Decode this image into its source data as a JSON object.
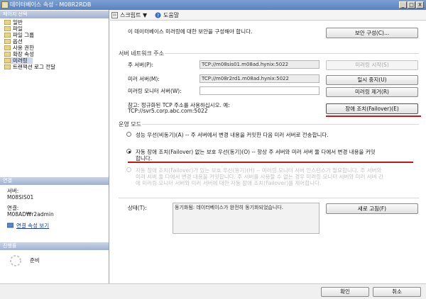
{
  "window": {
    "title": "데이터베이스 속성 - M08R2RDB",
    "controls": [
      "_",
      "□",
      "X"
    ]
  },
  "left": {
    "select_page_header": "페이지 선택",
    "nav_items": [
      "일반",
      "파일",
      "파일 그룹",
      "옵션",
      "사용 권한",
      "확장 속성",
      "미러링",
      "트랜잭션 로그 전달"
    ],
    "selected_index": 6,
    "connection_header": "연결",
    "server_label": "서버:",
    "server_value": "M08SIS01",
    "connection_label": "연결:",
    "connection_value": "M08AD₩r2admin",
    "connection_link": "연결 속성 보기",
    "progress_header": "진행률",
    "progress_status": "준비"
  },
  "toolbar": {
    "script_label": "스크립트 ▼",
    "help_label": "도움말"
  },
  "main": {
    "intro": "이 데이터베이스 미러링에 대한 보안을 구성해야 합니다.",
    "configure_security_button": "보안 구성(C)...",
    "network_group_label": "서버 네트워크 주소",
    "principal_label": "주 서버(P):",
    "principal_value": "TCP://m08sis01.m08ad.hynix:5022",
    "mirror_label": "미러 서버(M):",
    "mirror_value": "TCP://m08r2rd1.m08ad.hynix:5022",
    "witness_label": "미러링 모니터 서버(W):",
    "witness_value": "",
    "start_mirroring_button": "미러링 시작(S)",
    "pause_button": "일시 중지(U)",
    "remove_mirroring_button": "미러링 제거(R)",
    "failover_button": "장애 조치(Failover)(E)",
    "note_line1": "참고: 정규화된 TCP 주소를 사용하십시오. 예:",
    "note_line2": "TCP://svr5.corp.abc.com:5022",
    "operating_mode_label": "운영 모드",
    "mode_high_performance": "성능 우선(비동기)(A) -- 주 서버에서 변경 내용을 커밋한 다음 미러 서버로 전송합니다.",
    "mode_high_safety_line1": "자동 장애 조치(Failover) 없는 보호 우선(동기)(O) -- 항상 주 서버와 미러 서버 둘 다에서 변경 내용을 커밋",
    "mode_high_safety_line2": "합니다.",
    "mode_auto_failover_line1": "자동 장애 조치(Failover)가 있는 보호 우선(동기)(H) -- 미러링 모니터 서버 인스턴스가 필요합니다. 주 서버와",
    "mode_auto_failover_line2": "미러 서버 둘 다에서 변경 내용을 커밋합니다. 주 서버를 사용할 수 없는 경우 미러링 모니터 서버와 미러 서버 간",
    "mode_auto_failover_line3": "에 미러링 모니터 서버와 미러 서버에 대한 자동 장애 조치(Failover)를 제어합니다.",
    "selected_mode": "high_safety",
    "status_label": "상태(T):",
    "status_value": "동기화됨: 데이터베이스가 완전히 동기화되었습니다.",
    "refresh_button": "새로 고침(F)"
  },
  "footer": {
    "ok_button": "확인",
    "cancel_button": "취소"
  },
  "colors": {
    "titlebar": "#5b82c0",
    "section_header": "#9fb1d1",
    "highlight_line": "#c81414"
  }
}
